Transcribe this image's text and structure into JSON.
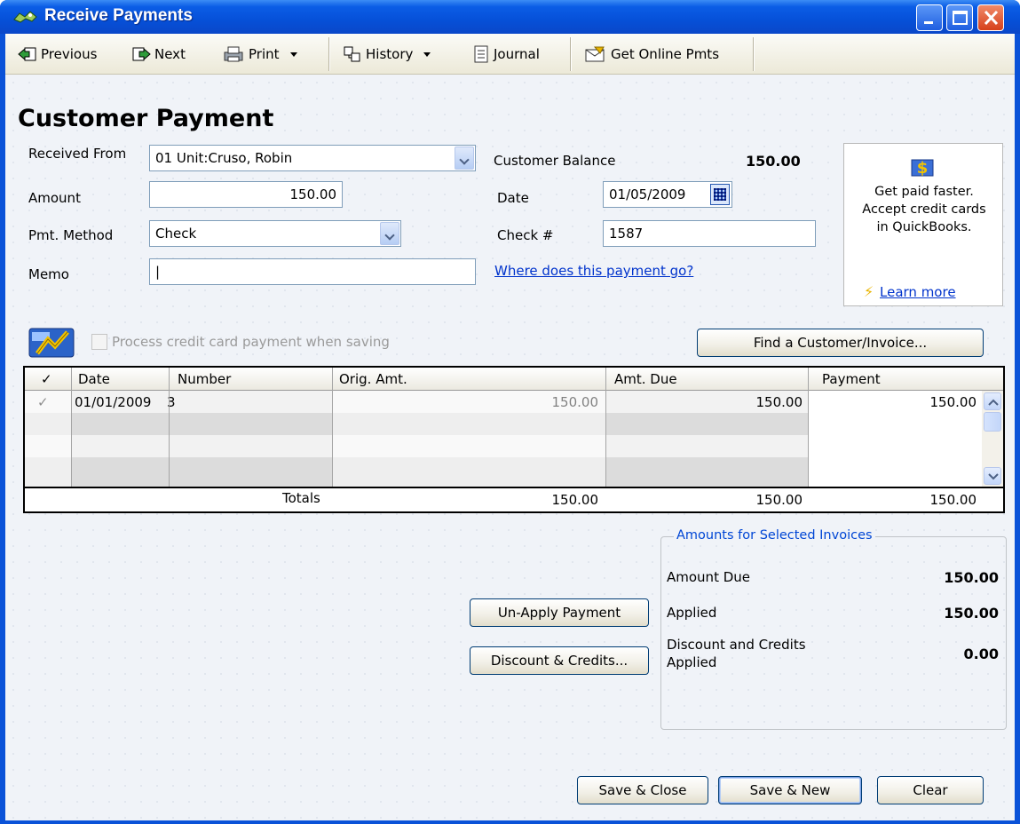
{
  "window": {
    "title": "Receive Payments"
  },
  "toolbar": {
    "previous": "Previous",
    "next": "Next",
    "print": "Print",
    "history": "History",
    "journal": "Journal",
    "get_online_pmts": "Get Online Pmts"
  },
  "form": {
    "title": "Customer Payment",
    "received_from_label": "Received From",
    "received_from_value": "01 Unit:Cruso, Robin",
    "amount_label": "Amount",
    "amount_value": "150.00",
    "pmt_method_label": "Pmt. Method",
    "pmt_method_value": "Check",
    "memo_label": "Memo",
    "memo_value": "|",
    "customer_balance_label": "Customer Balance",
    "customer_balance_value": "150.00",
    "date_label": "Date",
    "date_value": "01/05/2009",
    "check_label": "Check #",
    "check_value": "1587",
    "where_link": "Where does this payment go?"
  },
  "promo": {
    "line1": "Get paid faster.",
    "line2": "Accept credit cards",
    "line3": "in QuickBooks.",
    "learn_more": "Learn more"
  },
  "credit_card": {
    "label": "Process credit card payment when saving",
    "checked": false
  },
  "find_button": "Find a Customer/Invoice...",
  "table": {
    "headers": [
      "✓",
      "Date",
      "Number",
      "Orig. Amt.",
      "Amt. Due",
      "Payment"
    ],
    "rows": [
      {
        "check": "✓",
        "date": "01/01/2009",
        "number": "3",
        "orig": "150.00",
        "due": "150.00",
        "payment": "150.00"
      }
    ],
    "totals_label": "Totals",
    "totals": {
      "orig": "150.00",
      "due": "150.00",
      "payment": "150.00"
    }
  },
  "amounts": {
    "title": "Amounts for Selected Invoices",
    "amount_due_label": "Amount Due",
    "amount_due_value": "150.00",
    "applied_label": "Applied",
    "applied_value": "150.00",
    "discount_label_1": "Discount and Credits",
    "discount_label_2": "Applied",
    "discount_value": "0.00"
  },
  "buttons": {
    "unapply": "Un-Apply Payment",
    "discount": "Discount & Credits...",
    "save_close": "Save & Close",
    "save_new": "Save & New",
    "clear": "Clear"
  },
  "colors": {
    "titlebar": "#0a52d8",
    "link": "#0033cc",
    "group_title": "#0046d5"
  }
}
